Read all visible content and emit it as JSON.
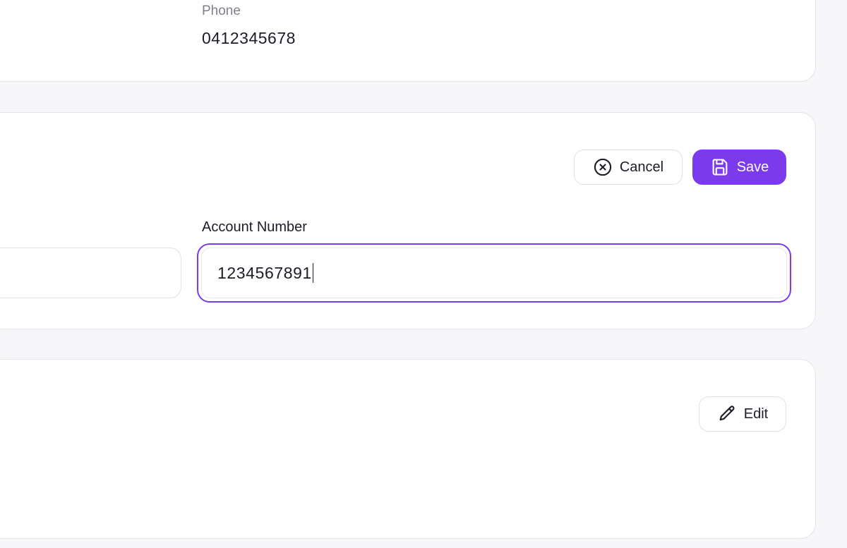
{
  "contact": {
    "phone_label": "Phone",
    "phone_value": "0412345678"
  },
  "bank": {
    "cancel_label": "Cancel",
    "save_label": "Save",
    "account_number_label": "Account Number",
    "account_number_value": "1234567891"
  },
  "other": {
    "edit_label": "Edit"
  },
  "colors": {
    "accent": "#7c3aed",
    "border": "#e4e4ea",
    "text": "#1c1c28",
    "muted": "#80808c"
  },
  "icons": {
    "cancel": "x-circle-icon",
    "save": "floppy-disk-icon",
    "edit": "pencil-icon"
  }
}
